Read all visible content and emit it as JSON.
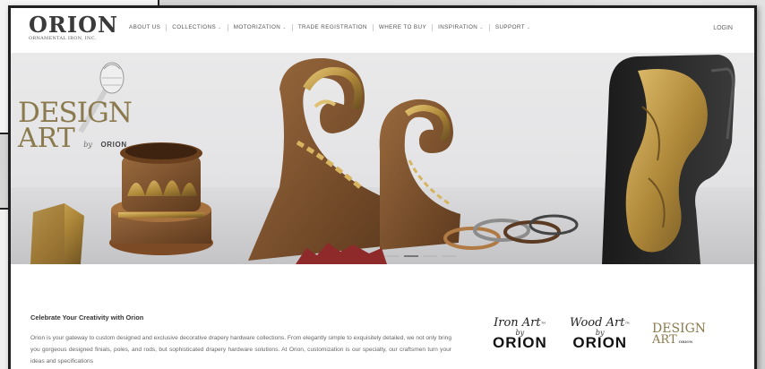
{
  "header": {
    "logo_word": "ORION",
    "logo_sub": "ORNAMENTAL IRON, INC.",
    "login": "LOGIN",
    "nav": [
      {
        "label": "ABOUT US",
        "dropdown": false
      },
      {
        "label": "COLLECTIONS",
        "dropdown": true
      },
      {
        "label": "MOTORIZATION",
        "dropdown": true
      },
      {
        "label": "TRADE REGISTRATION",
        "dropdown": false
      },
      {
        "label": "WHERE TO BUY",
        "dropdown": false
      },
      {
        "label": "INSPIRATION",
        "dropdown": true
      },
      {
        "label": "SUPPORT",
        "dropdown": true
      }
    ]
  },
  "hero": {
    "design_text": "DESIGN",
    "art_text": "ART",
    "by_text": "by",
    "orion_text": "ORION",
    "tm": "TM",
    "slides": 4,
    "active_slide": 2
  },
  "content": {
    "title": "Celebrate Your Creativity with Orion",
    "body": "Orion is your gateway to custom designed and exclusive decorative drapery hardware collections. From elegantly simple to exquisitely detailed, we not only bring you gorgeous designed finials, poles, and rods, but sophisticated drapery hardware solutions. At Orion, customization is our specialty, our craftsmen turn your ideas and specifications"
  },
  "brands": [
    {
      "script": "Iron Art",
      "by": "by",
      "name": "ORION",
      "tm": "™"
    },
    {
      "script": "Wood Art",
      "by": "by",
      "name": "ORION",
      "tm": "™"
    }
  ],
  "brand_design_art": {
    "design": "DESIGN",
    "art": "ART",
    "orion": "ORION"
  },
  "colors": {
    "gold": "#8a7a4e",
    "nav_text": "#555555",
    "frame": "#1f1f1f"
  }
}
